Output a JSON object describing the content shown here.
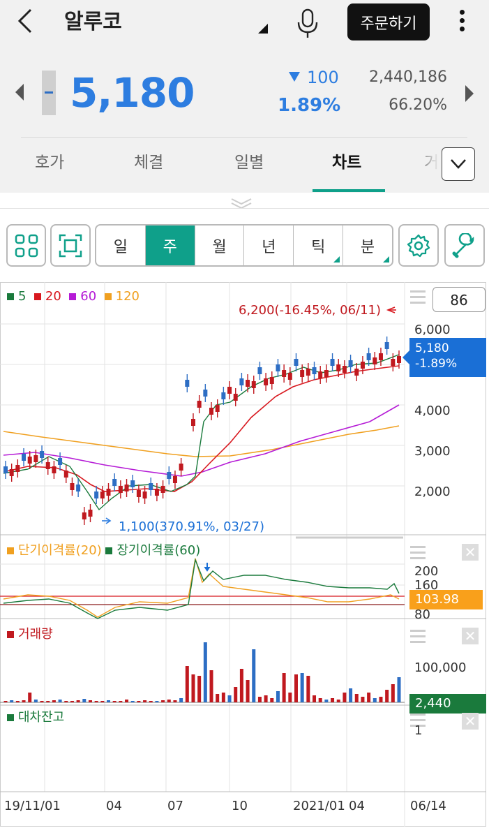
{
  "header": {
    "title": "알루코",
    "order_label": "주문하기"
  },
  "quote": {
    "price": "5,180",
    "change": "100",
    "change_pct": "1.89%",
    "volume": "2,440,186",
    "volume_ratio": "66.20%"
  },
  "tabs": [
    "호가",
    "체결",
    "일별",
    "차트",
    "거"
  ],
  "active_tab": "차트",
  "periods": [
    {
      "label": "일",
      "selected": false,
      "has_menu": false
    },
    {
      "label": "주",
      "selected": true,
      "has_menu": false
    },
    {
      "label": "월",
      "selected": false,
      "has_menu": false
    },
    {
      "label": "년",
      "selected": false,
      "has_menu": false
    },
    {
      "label": "틱",
      "selected": false,
      "has_menu": true
    },
    {
      "label": "분",
      "selected": false,
      "has_menu": true
    }
  ],
  "chart": {
    "candle_count": "86",
    "legend": [
      {
        "label": "5",
        "color": "#1a7a3c"
      },
      {
        "label": "20",
        "color": "#d8181f"
      },
      {
        "label": "60",
        "color": "#b51bd6"
      },
      {
        "label": "120",
        "color": "#f0a020"
      }
    ],
    "high_annotation": "6,200(-16.45%, 06/11)",
    "low_annotation": "1,100(370.91%, 03/27)",
    "price_tag_value": "5,180",
    "price_tag_change": "-1.89%",
    "y_ticks": [
      "6,000",
      "4,000",
      "3,000",
      "2,000"
    ],
    "indicator": {
      "legend": [
        {
          "label": "단기이격률(20)",
          "color": "#f0a020"
        },
        {
          "label": "장기이격률(60)",
          "color": "#1a7a3c"
        }
      ],
      "y_ticks": [
        "200",
        "160",
        "80"
      ],
      "tag": "103.98"
    },
    "volume": {
      "label": "거래량",
      "y_tick": "100,000",
      "tag": "2,440"
    },
    "loan": {
      "label": "대차잔고",
      "y_tick": "1"
    },
    "x_ticks": [
      "19/11/01",
      "04",
      "07",
      "10",
      "2021/01",
      "04",
      "06/14"
    ]
  },
  "chart_data": {
    "type": "candlestick",
    "period": "weekly",
    "last_close": 5180,
    "high": {
      "value": 6200,
      "pct": -16.45,
      "date": "06/11"
    },
    "low": {
      "value": 1100,
      "pct": 370.91,
      "date": "03/27"
    },
    "moving_averages": [
      "5",
      "20",
      "60",
      "120"
    ],
    "disparity_short_20_last": 103.98,
    "volume_last": 2440
  }
}
